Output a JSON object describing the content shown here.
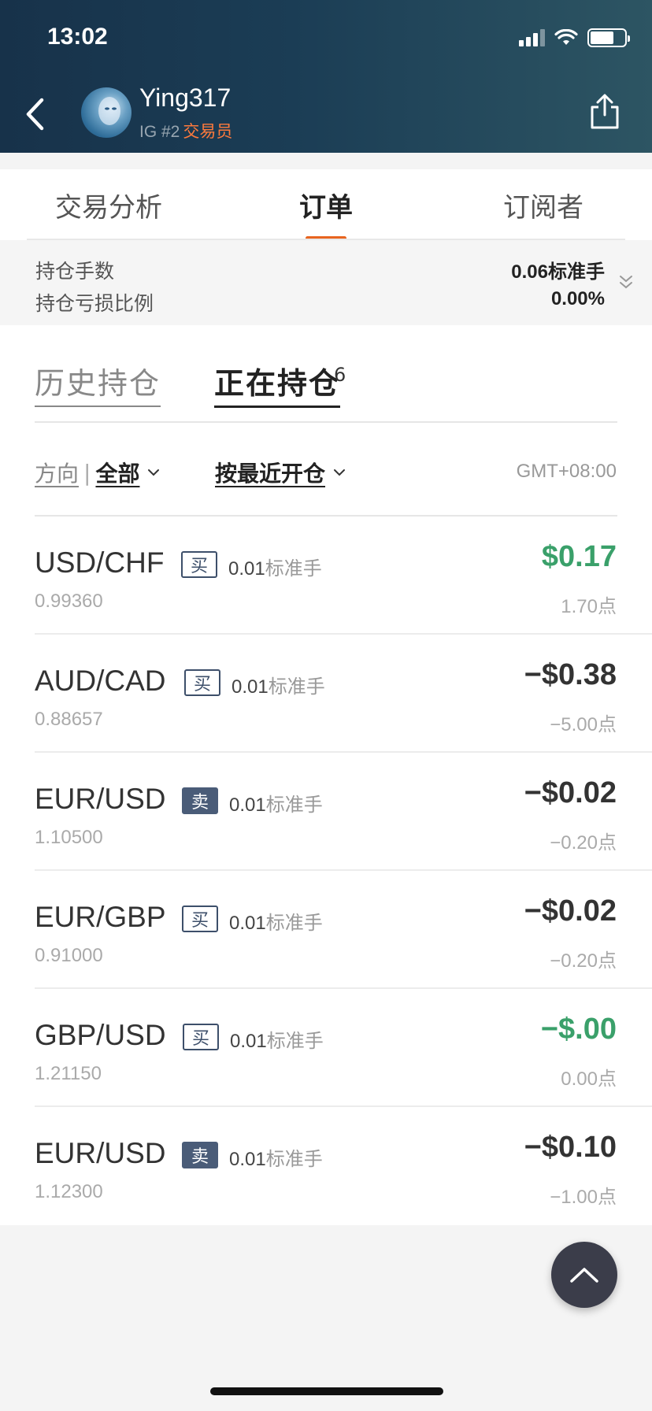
{
  "status_bar": {
    "time": "13:02"
  },
  "profile": {
    "name": "Ying317",
    "rank_text": "IG #2",
    "role": "交易员"
  },
  "tabs": [
    {
      "label": "交易分析",
      "active": false
    },
    {
      "label": "订单",
      "active": true
    },
    {
      "label": "订阅者",
      "active": false
    }
  ],
  "summary": {
    "lots_label": "持仓手数",
    "lots_value": "0.06标准手",
    "pl_ratio_label": "持仓亏损比例",
    "pl_ratio_value": "0.00%"
  },
  "subtabs": {
    "history_label": "历史持仓",
    "open_label": "正在持仓",
    "open_count": "6"
  },
  "filters": {
    "direction_label": "方向",
    "direction_value": "全部",
    "sort_label": "按最近开仓",
    "timezone": "GMT+08:00"
  },
  "positions": [
    {
      "pair": "USD/CHF",
      "side": "买",
      "side_type": "buy",
      "lots": "0.01",
      "lots_unit": "标准手",
      "price": "0.99360",
      "profit": "$0.17",
      "profit_color": "#3aa06a",
      "points": "1.70点"
    },
    {
      "pair": "AUD/CAD",
      "side": "买",
      "side_type": "buy",
      "lots": "0.01",
      "lots_unit": "标准手",
      "price": "0.88657",
      "profit": "−$0.38",
      "profit_color": "#333333",
      "points": "−5.00点"
    },
    {
      "pair": "EUR/USD",
      "side": "卖",
      "side_type": "sell",
      "lots": "0.01",
      "lots_unit": "标准手",
      "price": "1.10500",
      "profit": "−$0.02",
      "profit_color": "#333333",
      "points": "−0.20点"
    },
    {
      "pair": "EUR/GBP",
      "side": "买",
      "side_type": "buy",
      "lots": "0.01",
      "lots_unit": "标准手",
      "price": "0.91000",
      "profit": "−$0.02",
      "profit_color": "#333333",
      "points": "−0.20点"
    },
    {
      "pair": "GBP/USD",
      "side": "买",
      "side_type": "buy",
      "lots": "0.01",
      "lots_unit": "标准手",
      "price": "1.21150",
      "profit": "−$.00",
      "profit_color": "#3aa06a",
      "points": "0.00点"
    },
    {
      "pair": "EUR/USD",
      "side": "卖",
      "side_type": "sell",
      "lots": "0.01",
      "lots_unit": "标准手",
      "price": "1.12300",
      "profit": "−$0.10",
      "profit_color": "#333333",
      "points": "−1.00点"
    }
  ],
  "icons": {
    "back": "chevron-left-icon",
    "share": "share-icon",
    "scroll_top": "chevron-up-icon",
    "expand": "double-chevron-down-icon"
  }
}
